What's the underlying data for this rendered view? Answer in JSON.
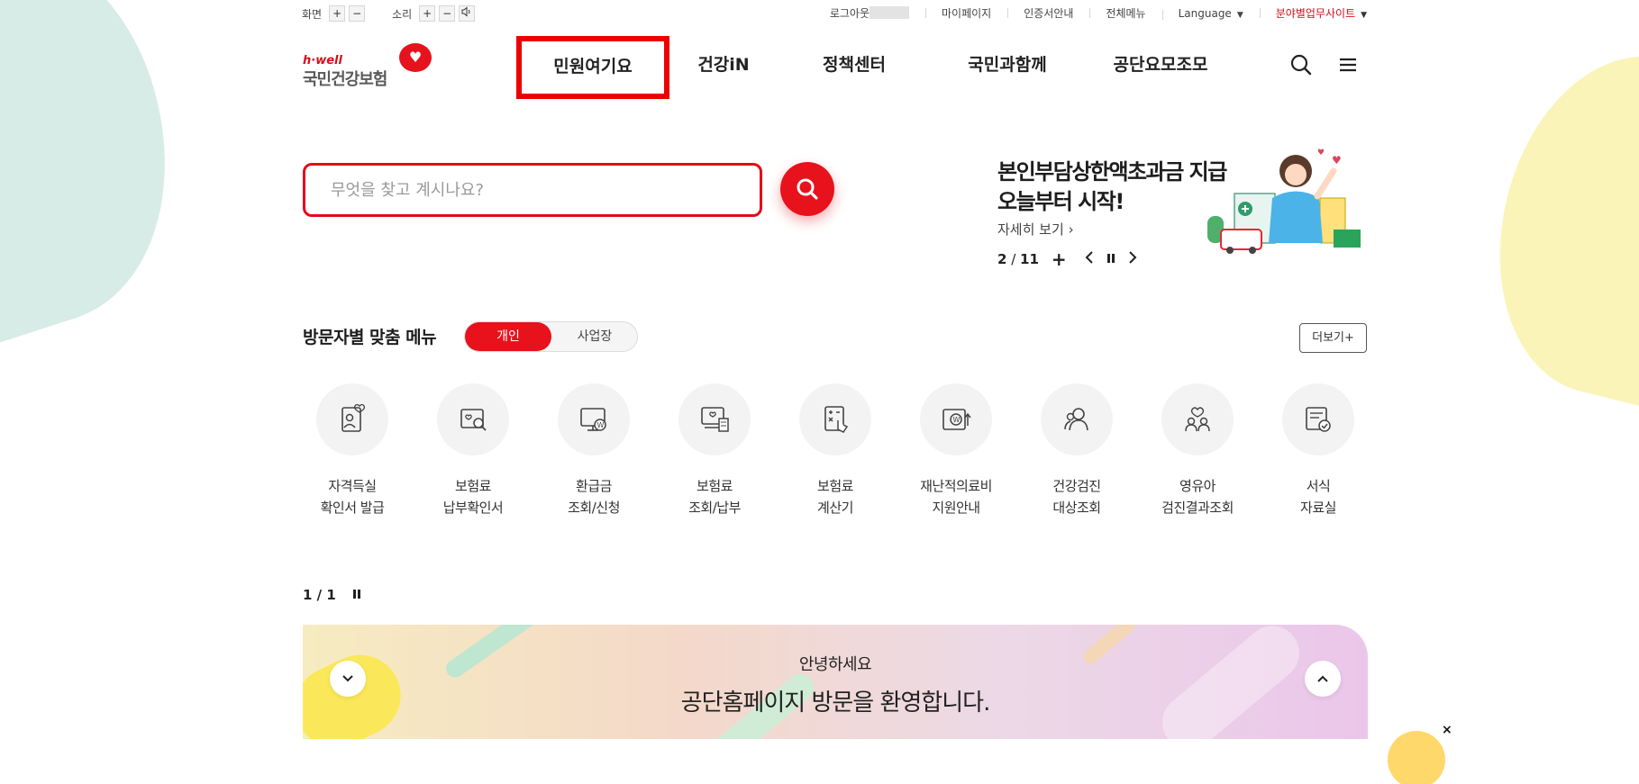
{
  "util": {
    "screen_label": "화면",
    "sound_label": "소리",
    "plus": "+",
    "minus": "−",
    "logout": "로그아웃",
    "mypage": "마이페이지",
    "cert": "인증서안내",
    "all_menu": "전체메뉴",
    "language": "Language",
    "field_sites": "분야별업무사이트"
  },
  "logo": {
    "top": "h·well",
    "main": "국민건강보험"
  },
  "nav": {
    "items": [
      "민원여기요",
      "건강iN",
      "정책센터",
      "국민과함께",
      "공단요모조모"
    ],
    "active_index": 0
  },
  "search": {
    "placeholder": "무엇을 찾고 계시나요?"
  },
  "banner": {
    "line1": "본인부담상한액초과금 지급",
    "line2": "오늘부터 시작!",
    "more": "자세히 보기",
    "current": "2",
    "total": "11"
  },
  "visitor": {
    "title": "방문자별 맞춤 메뉴",
    "tab_personal": "개인",
    "tab_business": "사업장",
    "more": "더보기+"
  },
  "quick_menu": [
    {
      "line1": "자격득실",
      "line2": "확인서 발급",
      "icon": "id-card-icon"
    },
    {
      "line1": "보험료",
      "line2": "납부확인서",
      "icon": "doc-search-icon"
    },
    {
      "line1": "환급금",
      "line2": "조회/신청",
      "icon": "monitor-won-icon"
    },
    {
      "line1": "보험료",
      "line2": "조회/납부",
      "icon": "receipt-heart-icon"
    },
    {
      "line1": "보험료",
      "line2": "계산기",
      "icon": "calculator-icon"
    },
    {
      "line1": "재난적의료비",
      "line2": "지원안내",
      "icon": "wallet-won-icon"
    },
    {
      "line1": "건강검진",
      "line2": "대상조회",
      "icon": "people-icon"
    },
    {
      "line1": "영유아",
      "line2": "검진결과조회",
      "icon": "family-heart-icon"
    },
    {
      "line1": "서식",
      "line2": "자료실",
      "icon": "form-check-icon"
    }
  ],
  "popup": {
    "current": "1",
    "total": "1",
    "sub": "안녕하세요",
    "main": "공단홈페이지 방문을 환영합니다."
  },
  "close": "×",
  "colors": {
    "brand_red": "#e8121c",
    "highlight_border": "#ee0000"
  }
}
